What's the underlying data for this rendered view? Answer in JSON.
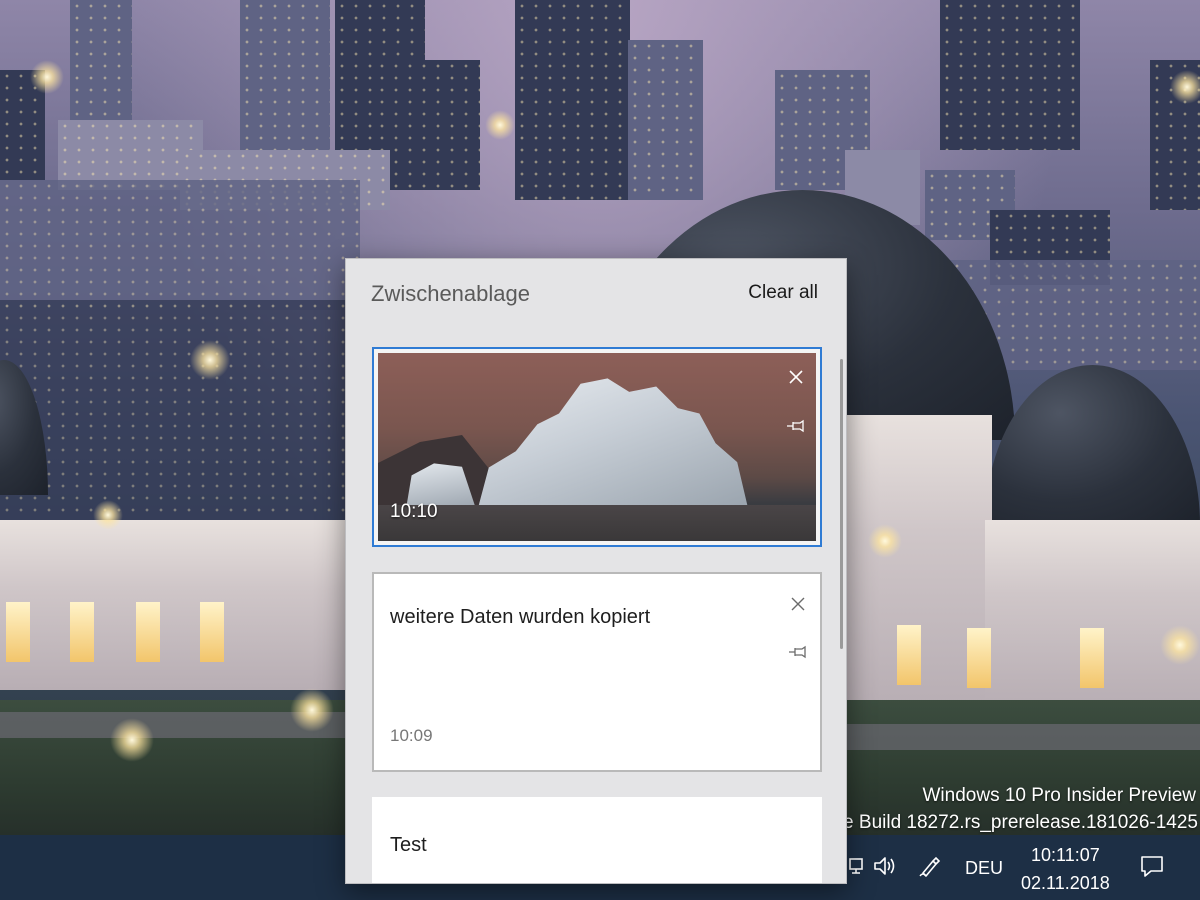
{
  "desktop": {
    "watermark_line1": "Windows 10 Pro Insider Preview",
    "watermark_line2": "oie Build 18272.rs_prerelease.181026-1425"
  },
  "clipboard": {
    "title": "Zwischenablage",
    "clear_all_label": "Clear all",
    "items": [
      {
        "type": "image",
        "time": "10:10",
        "selected": true
      },
      {
        "type": "text",
        "text": "weitere Daten wurden kopiert",
        "time": "10:09"
      },
      {
        "type": "text",
        "text": "Test"
      }
    ]
  },
  "taskbar": {
    "language": "DEU",
    "time": "10:11:07",
    "date": "02.11.2018",
    "icons": [
      "network-icon",
      "volume-icon",
      "pen-icon",
      "action-center-icon"
    ]
  },
  "colors": {
    "accent": "#2f7bd4",
    "taskbar": "#1d2f45"
  }
}
